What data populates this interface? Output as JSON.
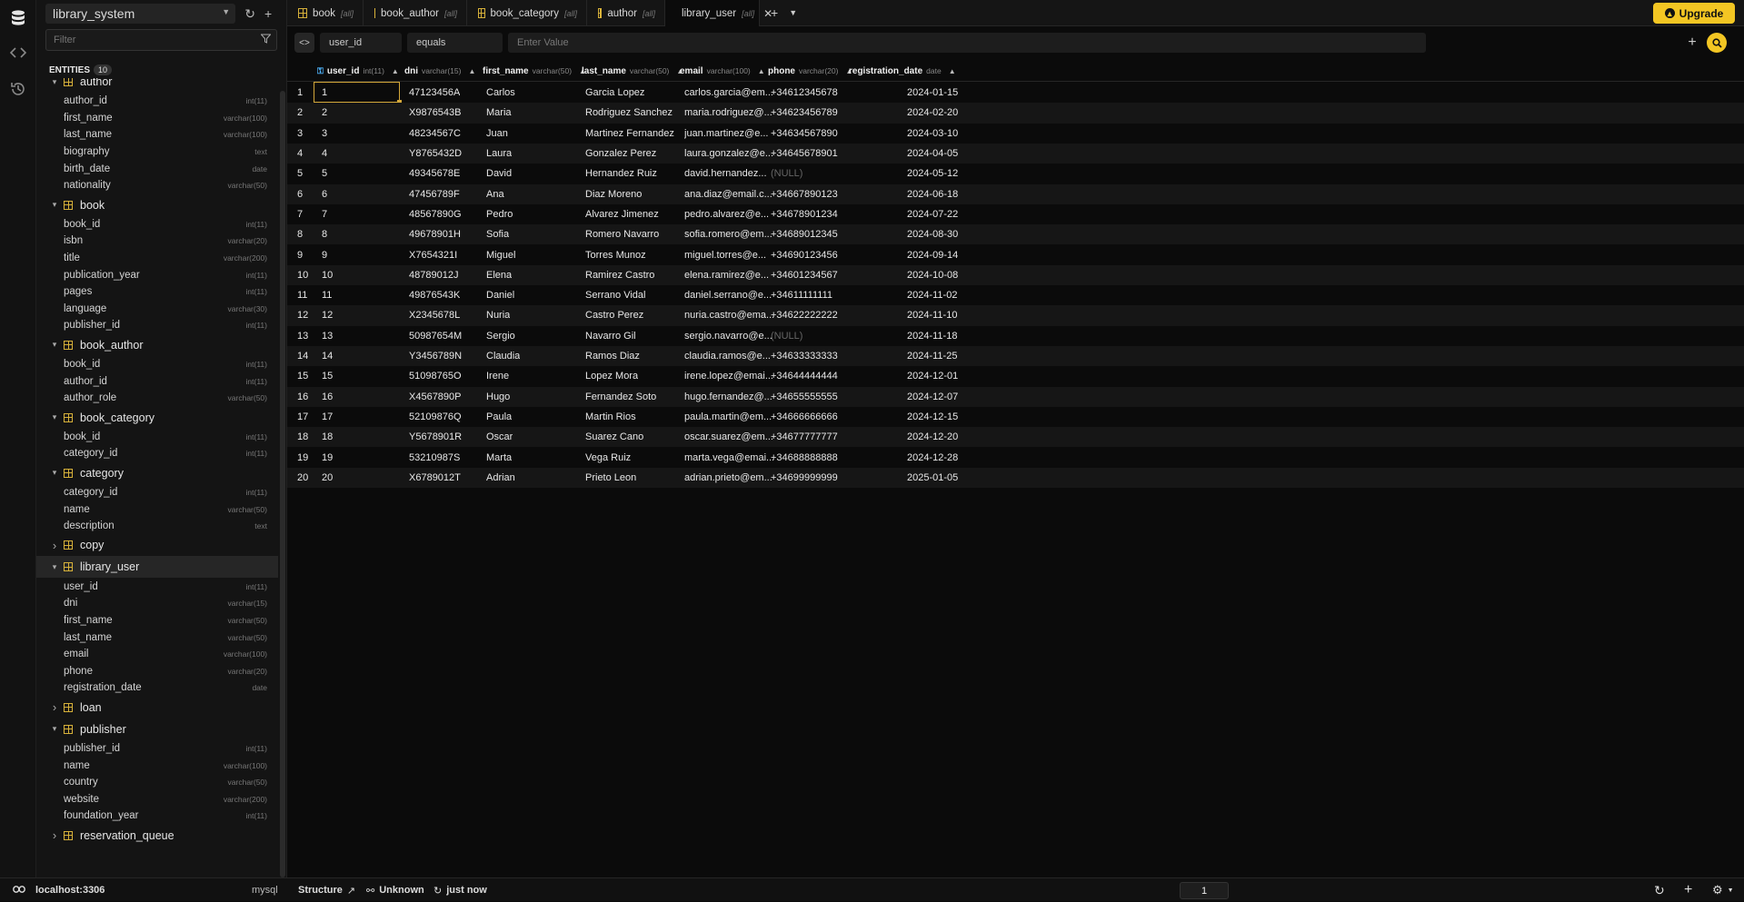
{
  "sidebar": {
    "database": "library_system",
    "filter_placeholder": "Filter",
    "entities_label": "ENTITIES",
    "entities_count": "10",
    "tables": [
      {
        "name": "author",
        "expanded": true,
        "columns": [
          {
            "name": "author_id",
            "type": "int(11)"
          },
          {
            "name": "first_name",
            "type": "varchar(100)"
          },
          {
            "name": "last_name",
            "type": "varchar(100)"
          },
          {
            "name": "biography",
            "type": "text"
          },
          {
            "name": "birth_date",
            "type": "date"
          },
          {
            "name": "nationality",
            "type": "varchar(50)"
          }
        ]
      },
      {
        "name": "book",
        "expanded": true,
        "columns": [
          {
            "name": "book_id",
            "type": "int(11)"
          },
          {
            "name": "isbn",
            "type": "varchar(20)"
          },
          {
            "name": "title",
            "type": "varchar(200)"
          },
          {
            "name": "publication_year",
            "type": "int(11)"
          },
          {
            "name": "pages",
            "type": "int(11)"
          },
          {
            "name": "language",
            "type": "varchar(30)"
          },
          {
            "name": "publisher_id",
            "type": "int(11)"
          }
        ]
      },
      {
        "name": "book_author",
        "expanded": true,
        "columns": [
          {
            "name": "book_id",
            "type": "int(11)"
          },
          {
            "name": "author_id",
            "type": "int(11)"
          },
          {
            "name": "author_role",
            "type": "varchar(50)"
          }
        ]
      },
      {
        "name": "book_category",
        "expanded": true,
        "columns": [
          {
            "name": "book_id",
            "type": "int(11)"
          },
          {
            "name": "category_id",
            "type": "int(11)"
          }
        ]
      },
      {
        "name": "category",
        "expanded": true,
        "columns": [
          {
            "name": "category_id",
            "type": "int(11)"
          },
          {
            "name": "name",
            "type": "varchar(50)"
          },
          {
            "name": "description",
            "type": "text"
          }
        ]
      },
      {
        "name": "copy",
        "expanded": false,
        "columns": []
      },
      {
        "name": "library_user",
        "expanded": true,
        "selected": true,
        "columns": [
          {
            "name": "user_id",
            "type": "int(11)"
          },
          {
            "name": "dni",
            "type": "varchar(15)"
          },
          {
            "name": "first_name",
            "type": "varchar(50)"
          },
          {
            "name": "last_name",
            "type": "varchar(50)"
          },
          {
            "name": "email",
            "type": "varchar(100)"
          },
          {
            "name": "phone",
            "type": "varchar(20)"
          },
          {
            "name": "registration_date",
            "type": "date"
          }
        ]
      },
      {
        "name": "loan",
        "expanded": false,
        "columns": []
      },
      {
        "name": "publisher",
        "expanded": true,
        "columns": [
          {
            "name": "publisher_id",
            "type": "int(11)"
          },
          {
            "name": "name",
            "type": "varchar(100)"
          },
          {
            "name": "country",
            "type": "varchar(50)"
          },
          {
            "name": "website",
            "type": "varchar(200)"
          },
          {
            "name": "foundation_year",
            "type": "int(11)"
          }
        ]
      },
      {
        "name": "reservation_queue",
        "expanded": false,
        "columns": []
      }
    ]
  },
  "tabs": [
    {
      "name": "book",
      "sub": "[all]",
      "active": false
    },
    {
      "name": "book_author",
      "sub": "[all]",
      "active": false
    },
    {
      "name": "book_category",
      "sub": "[all]",
      "active": false
    },
    {
      "name": "author",
      "sub": "[all]",
      "active": false
    },
    {
      "name": "library_user",
      "sub": "[all]",
      "active": true
    }
  ],
  "upgrade_label": "Upgrade",
  "filterbar": {
    "column": "user_id",
    "operator": "equals",
    "value_placeholder": "Enter Value"
  },
  "grid": {
    "columns": [
      {
        "name": "user_id",
        "type": "int(11)",
        "key": true
      },
      {
        "name": "dni",
        "type": "varchar(15)"
      },
      {
        "name": "first_name",
        "type": "varchar(50)"
      },
      {
        "name": "last_name",
        "type": "varchar(50)"
      },
      {
        "name": "email",
        "type": "varchar(100)"
      },
      {
        "name": "phone",
        "type": "varchar(20)"
      },
      {
        "name": "registration_date",
        "type": "date"
      }
    ],
    "rows": [
      [
        "1",
        "47123456A",
        "Carlos",
        "Garcia Lopez",
        "carlos.garcia@em...",
        "+34612345678",
        "2024-01-15"
      ],
      [
        "2",
        "X9876543B",
        "Maria",
        "Rodriguez Sanchez",
        "maria.rodriguez@...",
        "+34623456789",
        "2024-02-20"
      ],
      [
        "3",
        "48234567C",
        "Juan",
        "Martinez Fernandez",
        "juan.martinez@e...",
        "+34634567890",
        "2024-03-10"
      ],
      [
        "4",
        "Y8765432D",
        "Laura",
        "Gonzalez Perez",
        "laura.gonzalez@e...",
        "+34645678901",
        "2024-04-05"
      ],
      [
        "5",
        "49345678E",
        "David",
        "Hernandez Ruiz",
        "david.hernandez...",
        "(NULL)",
        "2024-05-12"
      ],
      [
        "6",
        "47456789F",
        "Ana",
        "Diaz Moreno",
        "ana.diaz@email.c...",
        "+34667890123",
        "2024-06-18"
      ],
      [
        "7",
        "48567890G",
        "Pedro",
        "Alvarez Jimenez",
        "pedro.alvarez@e...",
        "+34678901234",
        "2024-07-22"
      ],
      [
        "8",
        "49678901H",
        "Sofia",
        "Romero Navarro",
        "sofia.romero@em...",
        "+34689012345",
        "2024-08-30"
      ],
      [
        "9",
        "X7654321I",
        "Miguel",
        "Torres Munoz",
        "miguel.torres@e...",
        "+34690123456",
        "2024-09-14"
      ],
      [
        "10",
        "48789012J",
        "Elena",
        "Ramirez Castro",
        "elena.ramirez@e...",
        "+34601234567",
        "2024-10-08"
      ],
      [
        "11",
        "49876543K",
        "Daniel",
        "Serrano Vidal",
        "daniel.serrano@e...",
        "+34611111111",
        "2024-11-02"
      ],
      [
        "12",
        "X2345678L",
        "Nuria",
        "Castro Perez",
        "nuria.castro@ema...",
        "+34622222222",
        "2024-11-10"
      ],
      [
        "13",
        "50987654M",
        "Sergio",
        "Navarro Gil",
        "sergio.navarro@e...",
        "(NULL)",
        "2024-11-18"
      ],
      [
        "14",
        "Y3456789N",
        "Claudia",
        "Ramos Diaz",
        "claudia.ramos@e...",
        "+34633333333",
        "2024-11-25"
      ],
      [
        "15",
        "51098765O",
        "Irene",
        "Lopez Mora",
        "irene.lopez@emai...",
        "+34644444444",
        "2024-12-01"
      ],
      [
        "16",
        "X4567890P",
        "Hugo",
        "Fernandez Soto",
        "hugo.fernandez@...",
        "+34655555555",
        "2024-12-07"
      ],
      [
        "17",
        "52109876Q",
        "Paula",
        "Martin Rios",
        "paula.martin@em...",
        "+34666666666",
        "2024-12-15"
      ],
      [
        "18",
        "Y5678901R",
        "Oscar",
        "Suarez Cano",
        "oscar.suarez@em...",
        "+34677777777",
        "2024-12-20"
      ],
      [
        "19",
        "53210987S",
        "Marta",
        "Vega Ruiz",
        "marta.vega@emai...",
        "+34688888888",
        "2024-12-28"
      ],
      [
        "20",
        "X6789012T",
        "Adrian",
        "Prieto Leon",
        "adrian.prieto@em...",
        "+34699999999",
        "2025-01-05"
      ]
    ]
  },
  "statusbar": {
    "connection": "localhost:3306",
    "engine": "mysql",
    "structure_label": "Structure",
    "unknown_label": "Unknown",
    "time_label": "just now",
    "page": "1"
  },
  "colors": {
    "accent": "#f3c623",
    "table_icon": "#d8b23a",
    "key_icon": "#4fb6ff"
  }
}
